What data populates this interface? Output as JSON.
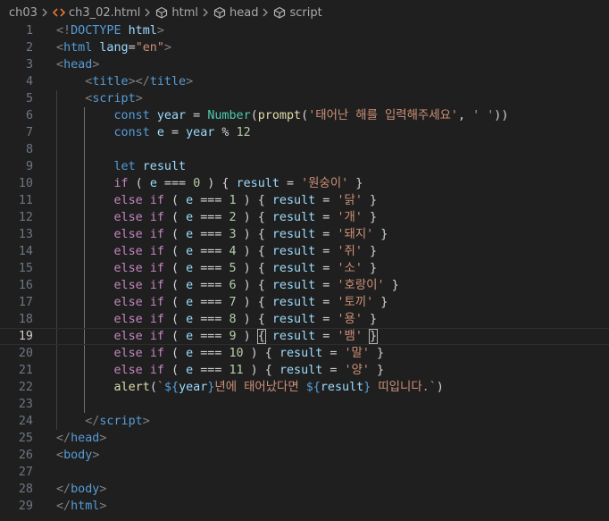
{
  "breadcrumb": {
    "items": [
      "ch03",
      "ch3_02.html",
      "html",
      "head",
      "script"
    ]
  },
  "editor": {
    "current_line": 19,
    "lines": [
      [
        [
          "t-br",
          "<!"
        ],
        [
          "t-tag",
          "DOCTYPE"
        ],
        [
          "t-op",
          " "
        ],
        [
          "t-attr",
          "html"
        ],
        [
          "t-br",
          ">"
        ]
      ],
      [
        [
          "t-br",
          "<"
        ],
        [
          "t-tag",
          "html"
        ],
        [
          "t-op",
          " "
        ],
        [
          "t-attr",
          "lang"
        ],
        [
          "t-op",
          "="
        ],
        [
          "t-str",
          "\"en\""
        ],
        [
          "t-br",
          ">"
        ]
      ],
      [
        [
          "t-br",
          "<"
        ],
        [
          "t-tag",
          "head"
        ],
        [
          "t-br",
          ">"
        ]
      ],
      [
        [
          "t-op",
          "    "
        ],
        [
          "t-br",
          "<"
        ],
        [
          "t-tag",
          "title"
        ],
        [
          "t-br",
          "></"
        ],
        [
          "t-tag",
          "title"
        ],
        [
          "t-br",
          ">"
        ]
      ],
      [
        [
          "t-op",
          "    "
        ],
        [
          "t-br",
          "<"
        ],
        [
          "t-tag",
          "script"
        ],
        [
          "t-br",
          ">"
        ]
      ],
      [
        [
          "t-op",
          "        "
        ],
        [
          "t-kw",
          "const"
        ],
        [
          "t-op",
          " "
        ],
        [
          "t-var",
          "year"
        ],
        [
          "t-op",
          " = "
        ],
        [
          "t-cls",
          "Number"
        ],
        [
          "t-punc",
          "("
        ],
        [
          "t-fn",
          "prompt"
        ],
        [
          "t-punc",
          "("
        ],
        [
          "t-str",
          "'태어난 해를 입력해주세요'"
        ],
        [
          "t-punc",
          ", "
        ],
        [
          "t-str",
          "' '"
        ],
        [
          "t-punc",
          "))"
        ]
      ],
      [
        [
          "t-op",
          "        "
        ],
        [
          "t-kw",
          "const"
        ],
        [
          "t-op",
          " "
        ],
        [
          "t-var",
          "e"
        ],
        [
          "t-op",
          " = "
        ],
        [
          "t-var",
          "year"
        ],
        [
          "t-op",
          " % "
        ],
        [
          "t-num",
          "12"
        ]
      ],
      [],
      [
        [
          "t-op",
          "        "
        ],
        [
          "t-kw",
          "let"
        ],
        [
          "t-op",
          " "
        ],
        [
          "t-var",
          "result"
        ]
      ],
      [
        [
          "t-op",
          "        "
        ],
        [
          "t-ctl",
          "if"
        ],
        [
          "t-op",
          " ( "
        ],
        [
          "t-var",
          "e"
        ],
        [
          "t-op",
          " === "
        ],
        [
          "t-num",
          "0"
        ],
        [
          "t-op",
          " ) { "
        ],
        [
          "t-var",
          "result"
        ],
        [
          "t-op",
          " = "
        ],
        [
          "t-str",
          "'원숭이'"
        ],
        [
          "t-op",
          " }"
        ]
      ],
      [
        [
          "t-op",
          "        "
        ],
        [
          "t-ctl",
          "else"
        ],
        [
          "t-op",
          " "
        ],
        [
          "t-ctl",
          "if"
        ],
        [
          "t-op",
          " ( "
        ],
        [
          "t-var",
          "e"
        ],
        [
          "t-op",
          " === "
        ],
        [
          "t-num",
          "1"
        ],
        [
          "t-op",
          " ) { "
        ],
        [
          "t-var",
          "result"
        ],
        [
          "t-op",
          " = "
        ],
        [
          "t-str",
          "'닭'"
        ],
        [
          "t-op",
          " }"
        ]
      ],
      [
        [
          "t-op",
          "        "
        ],
        [
          "t-ctl",
          "else"
        ],
        [
          "t-op",
          " "
        ],
        [
          "t-ctl",
          "if"
        ],
        [
          "t-op",
          " ( "
        ],
        [
          "t-var",
          "e"
        ],
        [
          "t-op",
          " === "
        ],
        [
          "t-num",
          "2"
        ],
        [
          "t-op",
          " ) { "
        ],
        [
          "t-var",
          "result"
        ],
        [
          "t-op",
          " = "
        ],
        [
          "t-str",
          "'개'"
        ],
        [
          "t-op",
          " }"
        ]
      ],
      [
        [
          "t-op",
          "        "
        ],
        [
          "t-ctl",
          "else"
        ],
        [
          "t-op",
          " "
        ],
        [
          "t-ctl",
          "if"
        ],
        [
          "t-op",
          " ( "
        ],
        [
          "t-var",
          "e"
        ],
        [
          "t-op",
          " === "
        ],
        [
          "t-num",
          "3"
        ],
        [
          "t-op",
          " ) { "
        ],
        [
          "t-var",
          "result"
        ],
        [
          "t-op",
          " = "
        ],
        [
          "t-str",
          "'돼지'"
        ],
        [
          "t-op",
          " }"
        ]
      ],
      [
        [
          "t-op",
          "        "
        ],
        [
          "t-ctl",
          "else"
        ],
        [
          "t-op",
          " "
        ],
        [
          "t-ctl",
          "if"
        ],
        [
          "t-op",
          " ( "
        ],
        [
          "t-var",
          "e"
        ],
        [
          "t-op",
          " === "
        ],
        [
          "t-num",
          "4"
        ],
        [
          "t-op",
          " ) { "
        ],
        [
          "t-var",
          "result"
        ],
        [
          "t-op",
          " = "
        ],
        [
          "t-str",
          "'쥐'"
        ],
        [
          "t-op",
          " }"
        ]
      ],
      [
        [
          "t-op",
          "        "
        ],
        [
          "t-ctl",
          "else"
        ],
        [
          "t-op",
          " "
        ],
        [
          "t-ctl",
          "if"
        ],
        [
          "t-op",
          " ( "
        ],
        [
          "t-var",
          "e"
        ],
        [
          "t-op",
          " === "
        ],
        [
          "t-num",
          "5"
        ],
        [
          "t-op",
          " ) { "
        ],
        [
          "t-var",
          "result"
        ],
        [
          "t-op",
          " = "
        ],
        [
          "t-str",
          "'소'"
        ],
        [
          "t-op",
          " }"
        ]
      ],
      [
        [
          "t-op",
          "        "
        ],
        [
          "t-ctl",
          "else"
        ],
        [
          "t-op",
          " "
        ],
        [
          "t-ctl",
          "if"
        ],
        [
          "t-op",
          " ( "
        ],
        [
          "t-var",
          "e"
        ],
        [
          "t-op",
          " === "
        ],
        [
          "t-num",
          "6"
        ],
        [
          "t-op",
          " ) { "
        ],
        [
          "t-var",
          "result"
        ],
        [
          "t-op",
          " = "
        ],
        [
          "t-str",
          "'호랑이'"
        ],
        [
          "t-op",
          " }"
        ]
      ],
      [
        [
          "t-op",
          "        "
        ],
        [
          "t-ctl",
          "else"
        ],
        [
          "t-op",
          " "
        ],
        [
          "t-ctl",
          "if"
        ],
        [
          "t-op",
          " ( "
        ],
        [
          "t-var",
          "e"
        ],
        [
          "t-op",
          " === "
        ],
        [
          "t-num",
          "7"
        ],
        [
          "t-op",
          " ) { "
        ],
        [
          "t-var",
          "result"
        ],
        [
          "t-op",
          " = "
        ],
        [
          "t-str",
          "'토끼'"
        ],
        [
          "t-op",
          " }"
        ]
      ],
      [
        [
          "t-op",
          "        "
        ],
        [
          "t-ctl",
          "else"
        ],
        [
          "t-op",
          " "
        ],
        [
          "t-ctl",
          "if"
        ],
        [
          "t-op",
          " ( "
        ],
        [
          "t-var",
          "e"
        ],
        [
          "t-op",
          " === "
        ],
        [
          "t-num",
          "8"
        ],
        [
          "t-op",
          " ) { "
        ],
        [
          "t-var",
          "result"
        ],
        [
          "t-op",
          " = "
        ],
        [
          "t-str",
          "'용'"
        ],
        [
          "t-op",
          " }"
        ]
      ],
      [
        [
          "t-op",
          "        "
        ],
        [
          "t-ctl",
          "else"
        ],
        [
          "t-op",
          " "
        ],
        [
          "t-ctl",
          "if"
        ],
        [
          "t-op",
          " ( "
        ],
        [
          "t-var",
          "e"
        ],
        [
          "t-op",
          " === "
        ],
        [
          "t-num",
          "9"
        ],
        [
          "t-op",
          " ) "
        ],
        [
          "t-op cursor-box",
          "{"
        ],
        [
          "t-op",
          " "
        ],
        [
          "t-var",
          "result"
        ],
        [
          "t-op",
          " = "
        ],
        [
          "t-str",
          "'뱀'"
        ],
        [
          "t-op",
          " "
        ],
        [
          "t-op cursor-box",
          "}"
        ]
      ],
      [
        [
          "t-op",
          "        "
        ],
        [
          "t-ctl",
          "else"
        ],
        [
          "t-op",
          " "
        ],
        [
          "t-ctl",
          "if"
        ],
        [
          "t-op",
          " ( "
        ],
        [
          "t-var",
          "e"
        ],
        [
          "t-op",
          " === "
        ],
        [
          "t-num",
          "10"
        ],
        [
          "t-op",
          " ) { "
        ],
        [
          "t-var",
          "result"
        ],
        [
          "t-op",
          " = "
        ],
        [
          "t-str",
          "'말'"
        ],
        [
          "t-op",
          " }"
        ]
      ],
      [
        [
          "t-op",
          "        "
        ],
        [
          "t-ctl",
          "else"
        ],
        [
          "t-op",
          " "
        ],
        [
          "t-ctl",
          "if"
        ],
        [
          "t-op",
          " ( "
        ],
        [
          "t-var",
          "e"
        ],
        [
          "t-op",
          " === "
        ],
        [
          "t-num",
          "11"
        ],
        [
          "t-op",
          " ) { "
        ],
        [
          "t-var",
          "result"
        ],
        [
          "t-op",
          " = "
        ],
        [
          "t-str",
          "'양'"
        ],
        [
          "t-op",
          " }"
        ]
      ],
      [
        [
          "t-op",
          "        "
        ],
        [
          "t-fn",
          "alert"
        ],
        [
          "t-punc",
          "("
        ],
        [
          "t-str",
          "`"
        ],
        [
          "t-tpl",
          "${"
        ],
        [
          "t-var",
          "year"
        ],
        [
          "t-tpl",
          "}"
        ],
        [
          "t-str",
          "년에 태어났다면 "
        ],
        [
          "t-tpl",
          "${"
        ],
        [
          "t-var",
          "result"
        ],
        [
          "t-tpl",
          "}"
        ],
        [
          "t-str",
          " 띠입니다.`"
        ],
        [
          "t-punc",
          ")"
        ]
      ],
      [],
      [
        [
          "t-op",
          "    "
        ],
        [
          "t-br",
          "</"
        ],
        [
          "t-tag",
          "script"
        ],
        [
          "t-br",
          ">"
        ]
      ],
      [
        [
          "t-br",
          "</"
        ],
        [
          "t-tag",
          "head"
        ],
        [
          "t-br",
          ">"
        ]
      ],
      [
        [
          "t-br",
          "<"
        ],
        [
          "t-tag",
          "body"
        ],
        [
          "t-br",
          ">"
        ]
      ],
      [],
      [
        [
          "t-br",
          "</"
        ],
        [
          "t-tag",
          "body"
        ],
        [
          "t-br",
          ">"
        ]
      ],
      [
        [
          "t-br",
          "</"
        ],
        [
          "t-tag",
          "html"
        ],
        [
          "t-br",
          ">"
        ]
      ]
    ]
  }
}
